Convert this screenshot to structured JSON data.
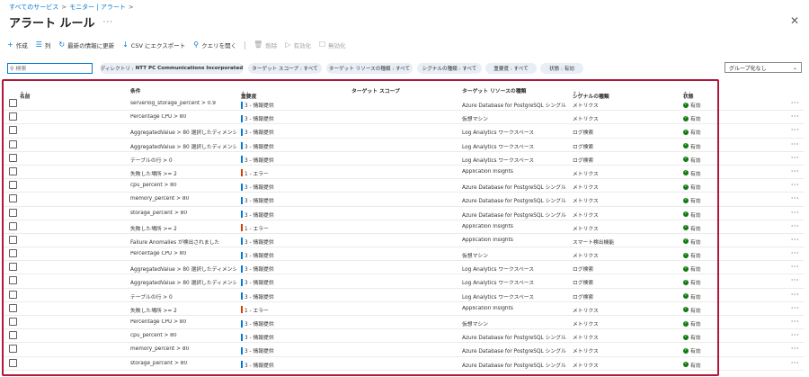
{
  "breadcrumb": {
    "item1": "すべてのサービス",
    "sep": ">",
    "item2": "モニター | アラート"
  },
  "title": "アラート ルール",
  "title_more": "···",
  "close": "✕",
  "toolbar": [
    {
      "icon": "+",
      "label": "作成",
      "disabled": false
    },
    {
      "icon": "☰",
      "label": "列",
      "disabled": false
    },
    {
      "icon": "↻",
      "label": "最新の情報に更新",
      "disabled": false
    },
    {
      "icon": "↓",
      "label": "CSV にエクスポート",
      "disabled": false
    },
    {
      "icon": "⚲",
      "label": "クエリを開く",
      "disabled": false
    },
    {
      "icon": "🗑",
      "label": "削除",
      "disabled": true
    },
    {
      "icon": "▷",
      "label": "有効化",
      "disabled": true
    },
    {
      "icon": "☐",
      "label": "無効化",
      "disabled": true
    }
  ],
  "search": {
    "placeholder": "検索",
    "icon": "⚲"
  },
  "filters": [
    {
      "key": "ディレクトリ :",
      "value": "NTT PC Communications Incorporated"
    },
    {
      "key": "ターゲット スコープ : すべて",
      "value": ""
    },
    {
      "key": "ターゲット リソースの種類 : すべて",
      "value": ""
    },
    {
      "key": "シグナルの種類 : すべて",
      "value": ""
    },
    {
      "key": "重要度 : すべて",
      "value": ""
    },
    {
      "key": "状態 : 有効",
      "value": ""
    }
  ],
  "group_by": {
    "value": "グループ化なし",
    "caret": "⌄"
  },
  "columns": {
    "name": "名前",
    "condition": "条件",
    "severity": "重要度",
    "scope": "ターゲット スコープ",
    "resource_type": "ターゲット リソースの種類",
    "signal": "シグナルの種類",
    "state": "状態",
    "sort_icon": "↑↓"
  },
  "rows": [
    {
      "condition": "serverlog_storage_percent > 0.9",
      "severity": "3 - 情報提供",
      "sev_level": "info",
      "resource_type": "Azure Database for PostgreSQL シングル サ...",
      "signal": "メトリクス",
      "state": "有効"
    },
    {
      "condition": "Percentage CPU > 80",
      "severity": "3 - 情報提供",
      "sev_level": "info",
      "resource_type": "仮想マシン",
      "signal": "メトリクス",
      "state": "有効"
    },
    {
      "condition": "AggregatedValue > 80 選択したディメンシヨン...",
      "severity": "3 - 情報提供",
      "sev_level": "info",
      "resource_type": "Log Analytics ワークスペース",
      "signal": "ログ検索",
      "state": "有効"
    },
    {
      "condition": "AggregatedValue > 80 選択したディメンシヨン...",
      "severity": "3 - 情報提供",
      "sev_level": "info",
      "resource_type": "Log Analytics ワークスペース",
      "signal": "ログ検索",
      "state": "有効"
    },
    {
      "condition": "テーブルの行 > 0",
      "severity": "3 - 情報提供",
      "sev_level": "info",
      "resource_type": "Log Analytics ワークスペース",
      "signal": "ログ検索",
      "state": "有効"
    },
    {
      "condition": "失敗した場所 >= 2",
      "severity": "1 - エラー",
      "sev_level": "error",
      "resource_type": "Application Insights",
      "signal": "メトリクス",
      "state": "有効"
    },
    {
      "condition": "cpu_percent > 80",
      "severity": "3 - 情報提供",
      "sev_level": "info",
      "resource_type": "Azure Database for PostgreSQL シングル サ...",
      "signal": "メトリクス",
      "state": "有効"
    },
    {
      "condition": "memory_percent > 80",
      "severity": "3 - 情報提供",
      "sev_level": "info",
      "resource_type": "Azure Database for PostgreSQL シングル サ...",
      "signal": "メトリクス",
      "state": "有効"
    },
    {
      "condition": "storage_percent > 80",
      "severity": "3 - 情報提供",
      "sev_level": "info",
      "resource_type": "Azure Database for PostgreSQL シングル サ...",
      "signal": "メトリクス",
      "state": "有効"
    },
    {
      "condition": "失敗した場所 >= 2",
      "severity": "1 - エラー",
      "sev_level": "error",
      "resource_type": "Application Insights",
      "signal": "メトリクス",
      "state": "有効"
    },
    {
      "condition": "Failure Anomalies が検出されました",
      "severity": "3 - 情報提供",
      "sev_level": "info",
      "resource_type": "Application Insights",
      "signal": "スマート検出機能",
      "state": "有効"
    },
    {
      "condition": "Percentage CPU > 80",
      "severity": "3 - 情報提供",
      "sev_level": "info",
      "resource_type": "仮想マシン",
      "signal": "メトリクス",
      "state": "有効"
    },
    {
      "condition": "AggregatedValue > 80 選択したディメンシヨン...",
      "severity": "3 - 情報提供",
      "sev_level": "info",
      "resource_type": "Log Analytics ワークスペース",
      "signal": "ログ検索",
      "state": "有効"
    },
    {
      "condition": "AggregatedValue > 80 選択したディメンシヨン...",
      "severity": "3 - 情報提供",
      "sev_level": "info",
      "resource_type": "Log Analytics ワークスペース",
      "signal": "ログ検索",
      "state": "有効"
    },
    {
      "condition": "テーブルの行 > 0",
      "severity": "3 - 情報提供",
      "sev_level": "info",
      "resource_type": "Log Analytics ワークスペース",
      "signal": "ログ検索",
      "state": "有効"
    },
    {
      "condition": "失敗した場所 >= 2",
      "severity": "1 - エラー",
      "sev_level": "error",
      "resource_type": "Application Insights",
      "signal": "メトリクス",
      "state": "有効"
    },
    {
      "condition": "Percentage CPU > 80",
      "severity": "3 - 情報提供",
      "sev_level": "info",
      "resource_type": "仮想マシン",
      "signal": "メトリクス",
      "state": "有効"
    },
    {
      "condition": "cpu_percent > 80",
      "severity": "3 - 情報提供",
      "sev_level": "info",
      "resource_type": "Azure Database for PostgreSQL シングル サ...",
      "signal": "メトリクス",
      "state": "有効"
    },
    {
      "condition": "memory_percent > 80",
      "severity": "3 - 情報提供",
      "sev_level": "info",
      "resource_type": "Azure Database for PostgreSQL シングル サ...",
      "signal": "メトリクス",
      "state": "有効"
    },
    {
      "condition": "storage_percent > 80",
      "severity": "3 - 情報提供",
      "sev_level": "info",
      "resource_type": "Azure Database for PostgreSQL シングル サ...",
      "signal": "メトリクス",
      "state": "有効"
    }
  ],
  "row_more": "···",
  "colors": {
    "accent": "#0078d4",
    "info": "#0078d4",
    "error": "#d83b01",
    "enabled": "#107c10",
    "highlight": "#b0173a"
  }
}
